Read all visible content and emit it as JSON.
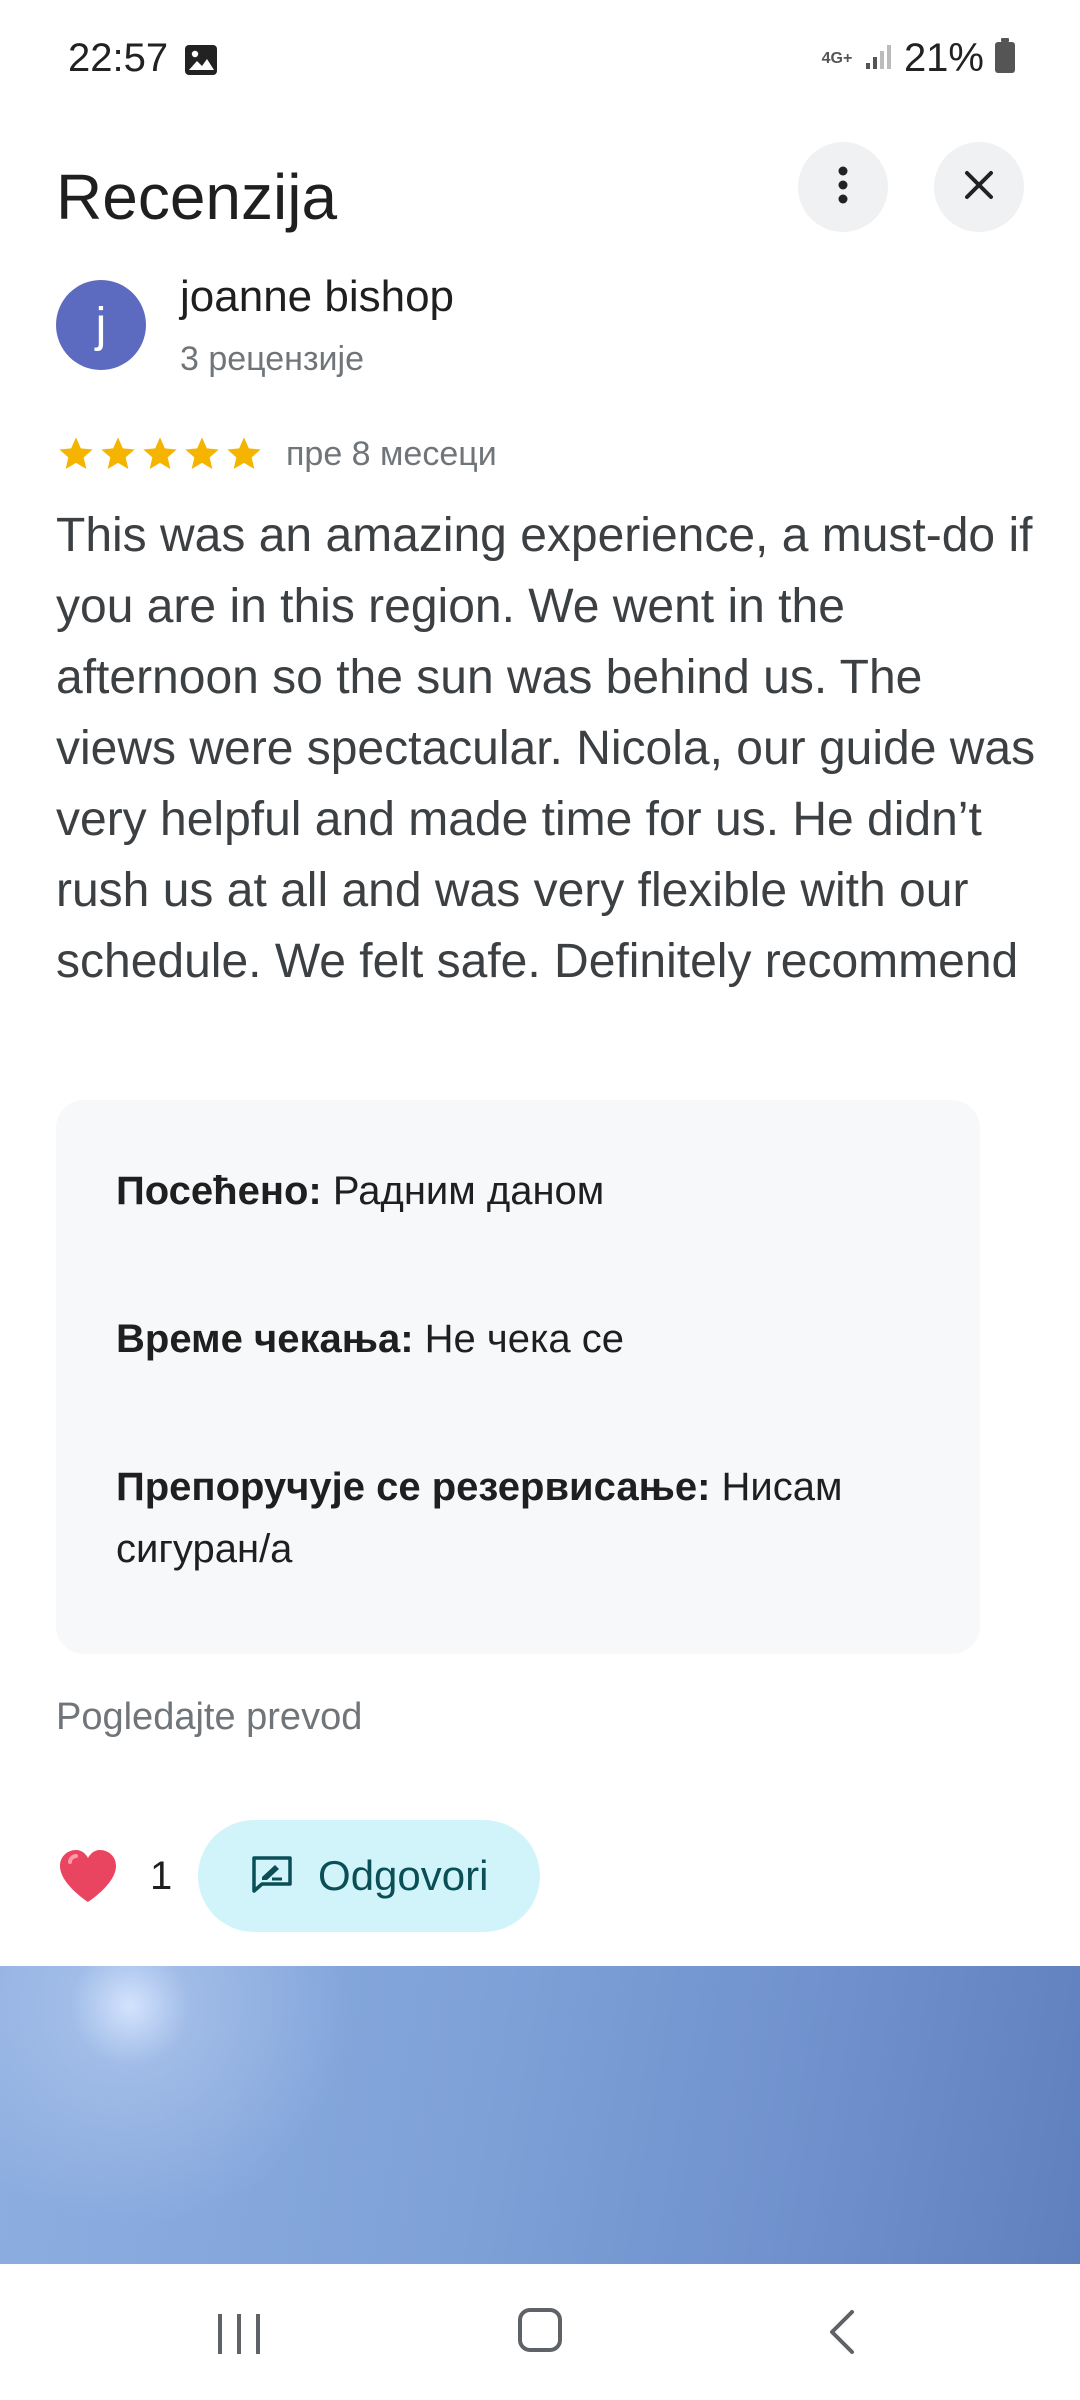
{
  "status_bar": {
    "time": "22:57",
    "network": "4G+",
    "battery": "21%",
    "icons": [
      "image-icon",
      "signal-icon",
      "battery-icon"
    ]
  },
  "header": {
    "title": "Recenzija",
    "more_icon": "more-vert-icon",
    "close_icon": "close-icon"
  },
  "review": {
    "avatar_letter": "j",
    "avatar_color": "#5c6bc0",
    "author": "joanne bishop",
    "author_reviews": "3 рецензије",
    "rating": 5,
    "rating_max": 5,
    "date": "пре 8 месеци",
    "text": "This was an amazing experience, a must-do if you are in this region. We went in the afternoon so the sun was behind us. The views were spectacular. Nicola, our guide was very helpful and made time for us. He didn’t rush us at all and was very flexible with our schedule. We felt safe. Definitely recommend"
  },
  "details": [
    {
      "label": "Посећено:",
      "value": "Радним даном"
    },
    {
      "label": "Време чекања:",
      "value": "Не чека се"
    },
    {
      "label": "Препоручује се резервисање:",
      "value": "Нисам сигуран/а"
    }
  ],
  "translate_link": "Pogledajte prevod",
  "actions": {
    "like_count": "1",
    "reply_label": "Odgovori",
    "accent": "#d1f4fb"
  }
}
